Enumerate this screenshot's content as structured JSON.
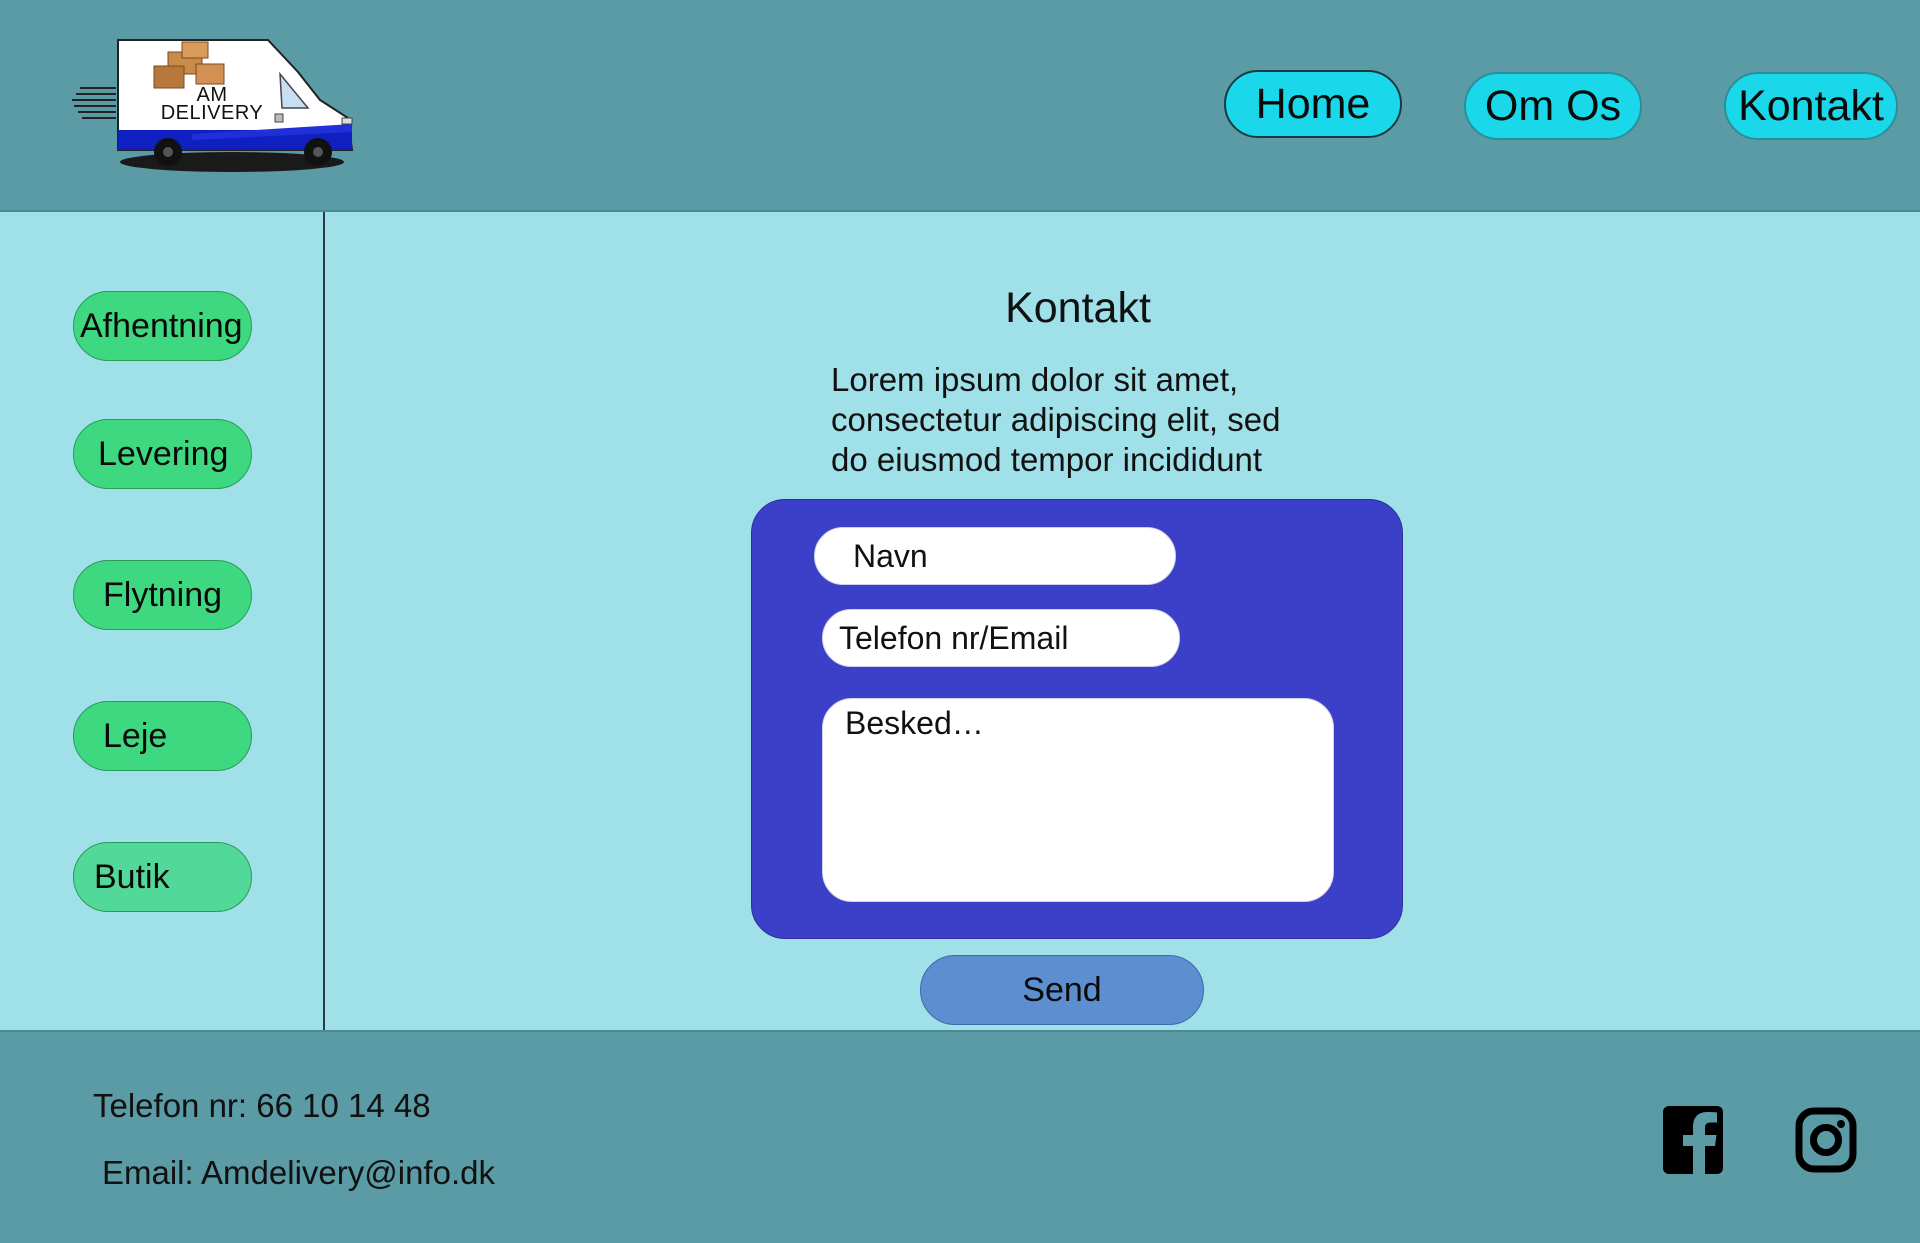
{
  "header": {
    "logo_text_line1": "AM",
    "logo_text_line2": "DELIVERY",
    "nav": {
      "home": "Home",
      "om_os": "Om Os",
      "kontakt": "Kontakt"
    }
  },
  "sidebar": {
    "items": [
      {
        "label": "Afhentning"
      },
      {
        "label": "Levering"
      },
      {
        "label": "Flytning"
      },
      {
        "label": "Leje"
      },
      {
        "label": "Butik"
      }
    ]
  },
  "main": {
    "title": "Kontakt",
    "description_line1": "Lorem ipsum dolor sit amet,",
    "description_line2": "consectetur adipiscing elit, sed",
    "description_line3": "do eiusmod tempor incididunt",
    "form": {
      "name_placeholder": "Navn",
      "contact_placeholder": "Telefon nr/Email",
      "message_placeholder": "Besked…",
      "send_label": "Send"
    }
  },
  "footer": {
    "phone": "Telefon nr: 66 10 14 48",
    "email": "Email: Amdelivery@info.dk"
  },
  "icons": {
    "facebook": "facebook-icon",
    "instagram": "instagram-icon"
  },
  "colors": {
    "header_bg": "#5a9ba6",
    "content_bg": "#a0e0e8",
    "nav_button": "#1ad8ea",
    "sidebar_button": "#3ed880",
    "form_panel": "#3c3fc8",
    "send_button": "#5d8fd0"
  }
}
